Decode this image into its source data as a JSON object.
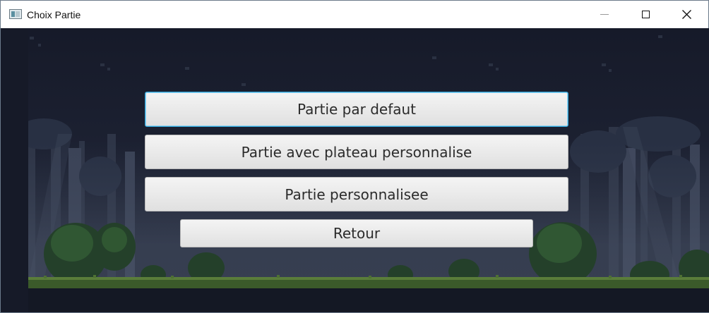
{
  "window": {
    "title": "Choix Partie",
    "controls": {
      "minimize": "minimize",
      "maximize": "maximize",
      "close": "close"
    }
  },
  "menu": {
    "buttons": [
      {
        "label": "Partie par defaut"
      },
      {
        "label": "Partie avec plateau personnalise"
      },
      {
        "label": "Partie personnalisee"
      },
      {
        "label": "Retour"
      }
    ]
  },
  "icons": {
    "app": "app-window-icon",
    "minimize": "minimize-icon",
    "maximize": "maximize-icon",
    "close": "close-icon"
  },
  "colors": {
    "background": "#171b2a",
    "grass": "#3b5a2a",
    "button": "#e8e8e8",
    "focus": "#2fa4d8"
  }
}
